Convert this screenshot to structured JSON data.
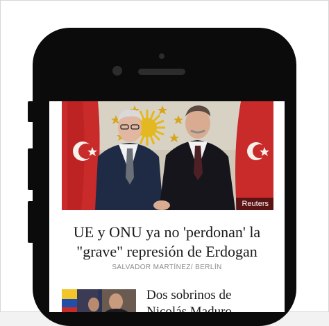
{
  "article": {
    "image_credit": "Reuters",
    "headline_line1": "UE y ONU ya no 'perdonan' la",
    "headline_line2": "\"grave\" represión de Erdogan",
    "byline": "SALVADOR MARTÍNEZ/ BERLÍN"
  },
  "related": {
    "title_line1": "Dos sobrinos de",
    "title_line2": "Nicolás Maduro"
  },
  "colors": {
    "flag_red": "#d22d2d",
    "phone_body": "#0b0b0b",
    "emblem_gold": "#e4b820"
  }
}
